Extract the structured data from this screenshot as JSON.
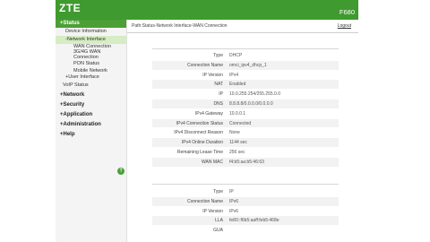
{
  "header": {
    "brand": "ZTE",
    "model": "F680",
    "color": "#3f9a2f"
  },
  "sidebar": {
    "items": [
      {
        "label": "+Status",
        "level": "top"
      },
      {
        "label": "Device Information",
        "level": "sub"
      },
      {
        "label": "-Network Interface",
        "level": "sub"
      },
      {
        "label": "WAN Connection",
        "level": "leaf"
      },
      {
        "label": "3G/4G WAN",
        "level": "leaf"
      },
      {
        "label": "Connection",
        "level": "leaf"
      },
      {
        "label": "PON Status",
        "level": "leaf"
      },
      {
        "label": "Mobile Network",
        "level": "leaf"
      },
      {
        "label": "+User Interface",
        "level": "sub"
      },
      {
        "label": "VoIP Status",
        "level": "sub"
      },
      {
        "label": "+Network",
        "level": "top"
      },
      {
        "label": "+Security",
        "level": "top"
      },
      {
        "label": "+Application",
        "level": "top"
      },
      {
        "label": "+Administration",
        "level": "top"
      },
      {
        "label": "+Help",
        "level": "top"
      }
    ],
    "back_icon": "arrow-up-circle-icon"
  },
  "topbar": {
    "breadcrumb": "Path:Status-Network Interface-WAN Connection",
    "logout": "Logout"
  },
  "ipv4": [
    {
      "label": "Type",
      "value": "DHCP"
    },
    {
      "label": "Connection Name",
      "value": "omci_ipv4_dhcp_1"
    },
    {
      "label": "IP Version",
      "value": "IPv4"
    },
    {
      "label": "NAT",
      "value": "Enabled"
    },
    {
      "label": "IP",
      "value": "10.0.255.254/255.255.0.0"
    },
    {
      "label": "DNS",
      "value": "8.8.8.8/0.0.0.0/0.0.0.0"
    },
    {
      "label": "IPv4 Gateway",
      "value": "10.0.0.1"
    },
    {
      "label": "IPv4 Connection Status",
      "value": "Connected"
    },
    {
      "label": "IPv4 Disconnect Reason",
      "value": "None"
    },
    {
      "label": "IPv4 Online Duration",
      "value": "1144 sec"
    },
    {
      "label": "Remaining Lease Time",
      "value": "256 sec"
    },
    {
      "label": "WAN MAC",
      "value": "f4:b5:aa:b5:46:63"
    }
  ],
  "ipv6": [
    {
      "label": "Type",
      "value": "IP"
    },
    {
      "label": "Connection Name",
      "value": "IPv6"
    },
    {
      "label": "IP Version",
      "value": "IPv6"
    },
    {
      "label": "LLA",
      "value": "fe80::f6b5:aaff:feb5:468e"
    },
    {
      "label": "GUA",
      "value": ""
    }
  ]
}
